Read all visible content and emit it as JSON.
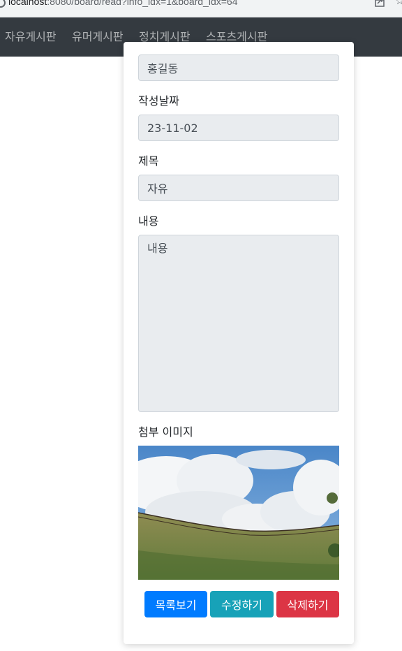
{
  "browser": {
    "url_host": "localhost",
    "url_path": ":8080/board/read?info_idx=1&board_idx=64"
  },
  "navbar": {
    "items": [
      {
        "label": "자유게시판"
      },
      {
        "label": "유머게시판"
      },
      {
        "label": "정치게시판"
      },
      {
        "label": "스포츠게시판"
      }
    ]
  },
  "form": {
    "writer": {
      "value": "홍길동"
    },
    "date": {
      "label": "작성날짜",
      "value": "23-11-02"
    },
    "subject": {
      "label": "제목",
      "value": "자유"
    },
    "content": {
      "label": "내용",
      "value": "내용"
    },
    "image": {
      "label": "첨부 이미지"
    }
  },
  "buttons": {
    "list": "목록보기",
    "edit": "수정하기",
    "delete": "삭제하기"
  },
  "colors": {
    "navbar": "#343a40",
    "primary": "#007bff",
    "info": "#17a2b8",
    "danger": "#dc3545"
  }
}
